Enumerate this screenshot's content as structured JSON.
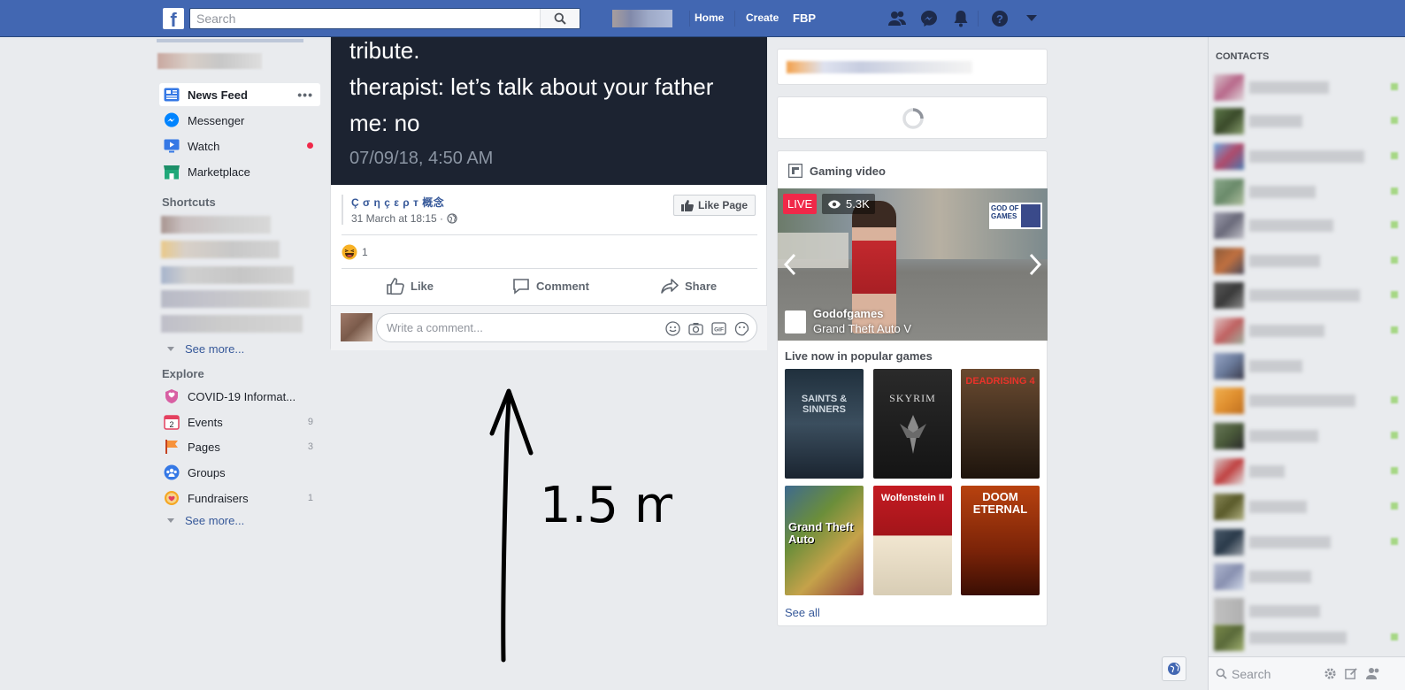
{
  "topbar": {
    "logo": "f",
    "search_placeholder": "Search",
    "nav": {
      "home": "Home",
      "create": "Create",
      "fbp": "FBP"
    },
    "icons": [
      "friends-icon",
      "messenger-icon",
      "notifications-icon",
      "help-icon",
      "account-menu-icon"
    ]
  },
  "left_nav": {
    "main": [
      {
        "label": "News Feed",
        "icon": "news-feed-icon"
      },
      {
        "label": "Messenger",
        "icon": "messenger-icon"
      },
      {
        "label": "Watch",
        "icon": "watch-icon"
      },
      {
        "label": "Marketplace",
        "icon": "marketplace-icon"
      }
    ],
    "shortcuts_title": "Shortcuts",
    "see_more": "See more...",
    "explore_title": "Explore",
    "explore": [
      {
        "label": "COVID-19 Informat...",
        "count": ""
      },
      {
        "label": "Events",
        "count": "9"
      },
      {
        "label": "Pages",
        "count": "3"
      },
      {
        "label": "Groups",
        "count": ""
      },
      {
        "label": "Fundraisers",
        "count": "1"
      }
    ],
    "see_more_2": "See more..."
  },
  "post": {
    "image_text": {
      "line1": "tribute.",
      "line2": "therapist: let’s talk about your father",
      "line3": "me: no",
      "date": "07/09/18, 4:50 AM"
    },
    "page_name": "Ç σ η ç ε ρ т 概念",
    "time": "31 March at 18:15 ·",
    "like_page": "Like Page",
    "reaction_count": "1",
    "actions": {
      "like": "Like",
      "comment": "Comment",
      "share": "Share"
    },
    "comment_placeholder": "Write a comment..."
  },
  "drawing": {
    "label": "1.5 m"
  },
  "right": {
    "gaming_title": "Gaming video",
    "live": "LIVE",
    "views": "5.3K",
    "channel": "Godofgames",
    "game": "Grand Theft Auto V",
    "live_now_title": "Live now in popular games",
    "tiles": [
      {
        "title": "SAINTS & SINNERS",
        "bg": "#1e2a35"
      },
      {
        "title": "SKYRIM",
        "bg": "#1a1a1a"
      },
      {
        "title": "DEADRISING 4",
        "bg": "#5a3a24"
      },
      {
        "title": "Grand Theft Auto",
        "bg": "#2d3a24"
      },
      {
        "title": "Wolfenstein II",
        "bg": "#b4171d"
      },
      {
        "title": "DOOM ETERNAL",
        "bg": "#8a2c0e"
      }
    ],
    "see_all": "See all"
  },
  "contacts": {
    "title": "CONTACTS",
    "search_placeholder": "Search"
  },
  "colors": {
    "brand": "#4267b2",
    "link": "#365899",
    "live": "#f02849",
    "online": "#42b72a"
  }
}
